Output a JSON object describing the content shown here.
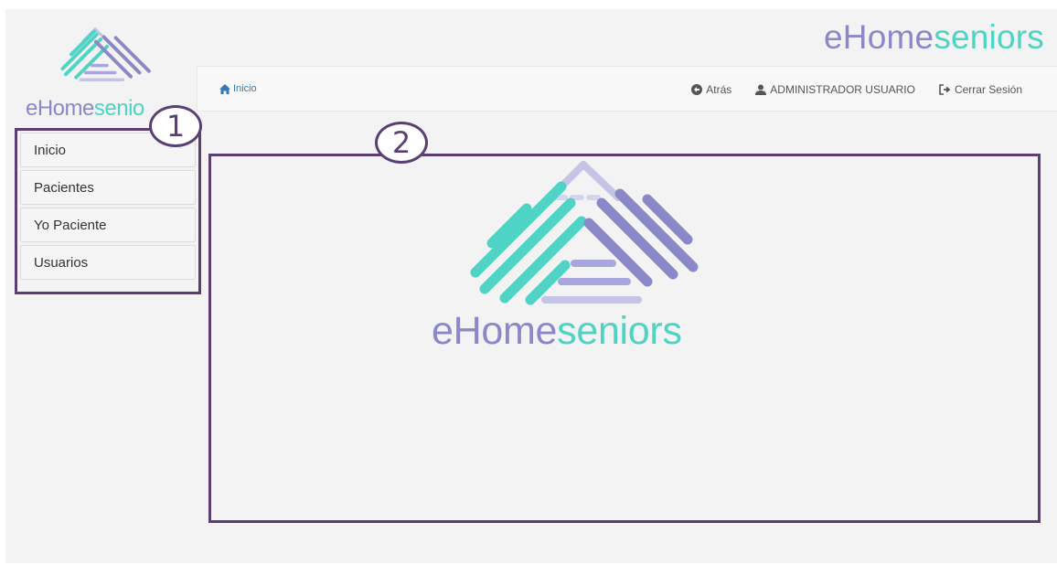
{
  "brand": {
    "part1": "eHome",
    "part2": "seniors"
  },
  "sidebar_logo": {
    "part1": "eHome",
    "part2": "senio"
  },
  "navbar": {
    "home": "Inicio",
    "back": "Atrás",
    "user": "ADMINISTRADOR USUARIO",
    "logout": "Cerrar Sesión"
  },
  "sidebar": {
    "items": [
      {
        "label": "Inicio"
      },
      {
        "label": "Pacientes"
      },
      {
        "label": "Yo Paciente"
      },
      {
        "label": "Usuarios"
      }
    ]
  },
  "callouts": {
    "one": "1",
    "two": "2"
  },
  "colors": {
    "teal": "#4ed3c4",
    "purple": "#8b88c9",
    "frame": "#5a3f72",
    "link": "#337ab7"
  },
  "icons": {
    "home": "home-icon",
    "back": "circle-arrow-left-icon",
    "user": "user-icon",
    "logout": "log-out-icon"
  }
}
